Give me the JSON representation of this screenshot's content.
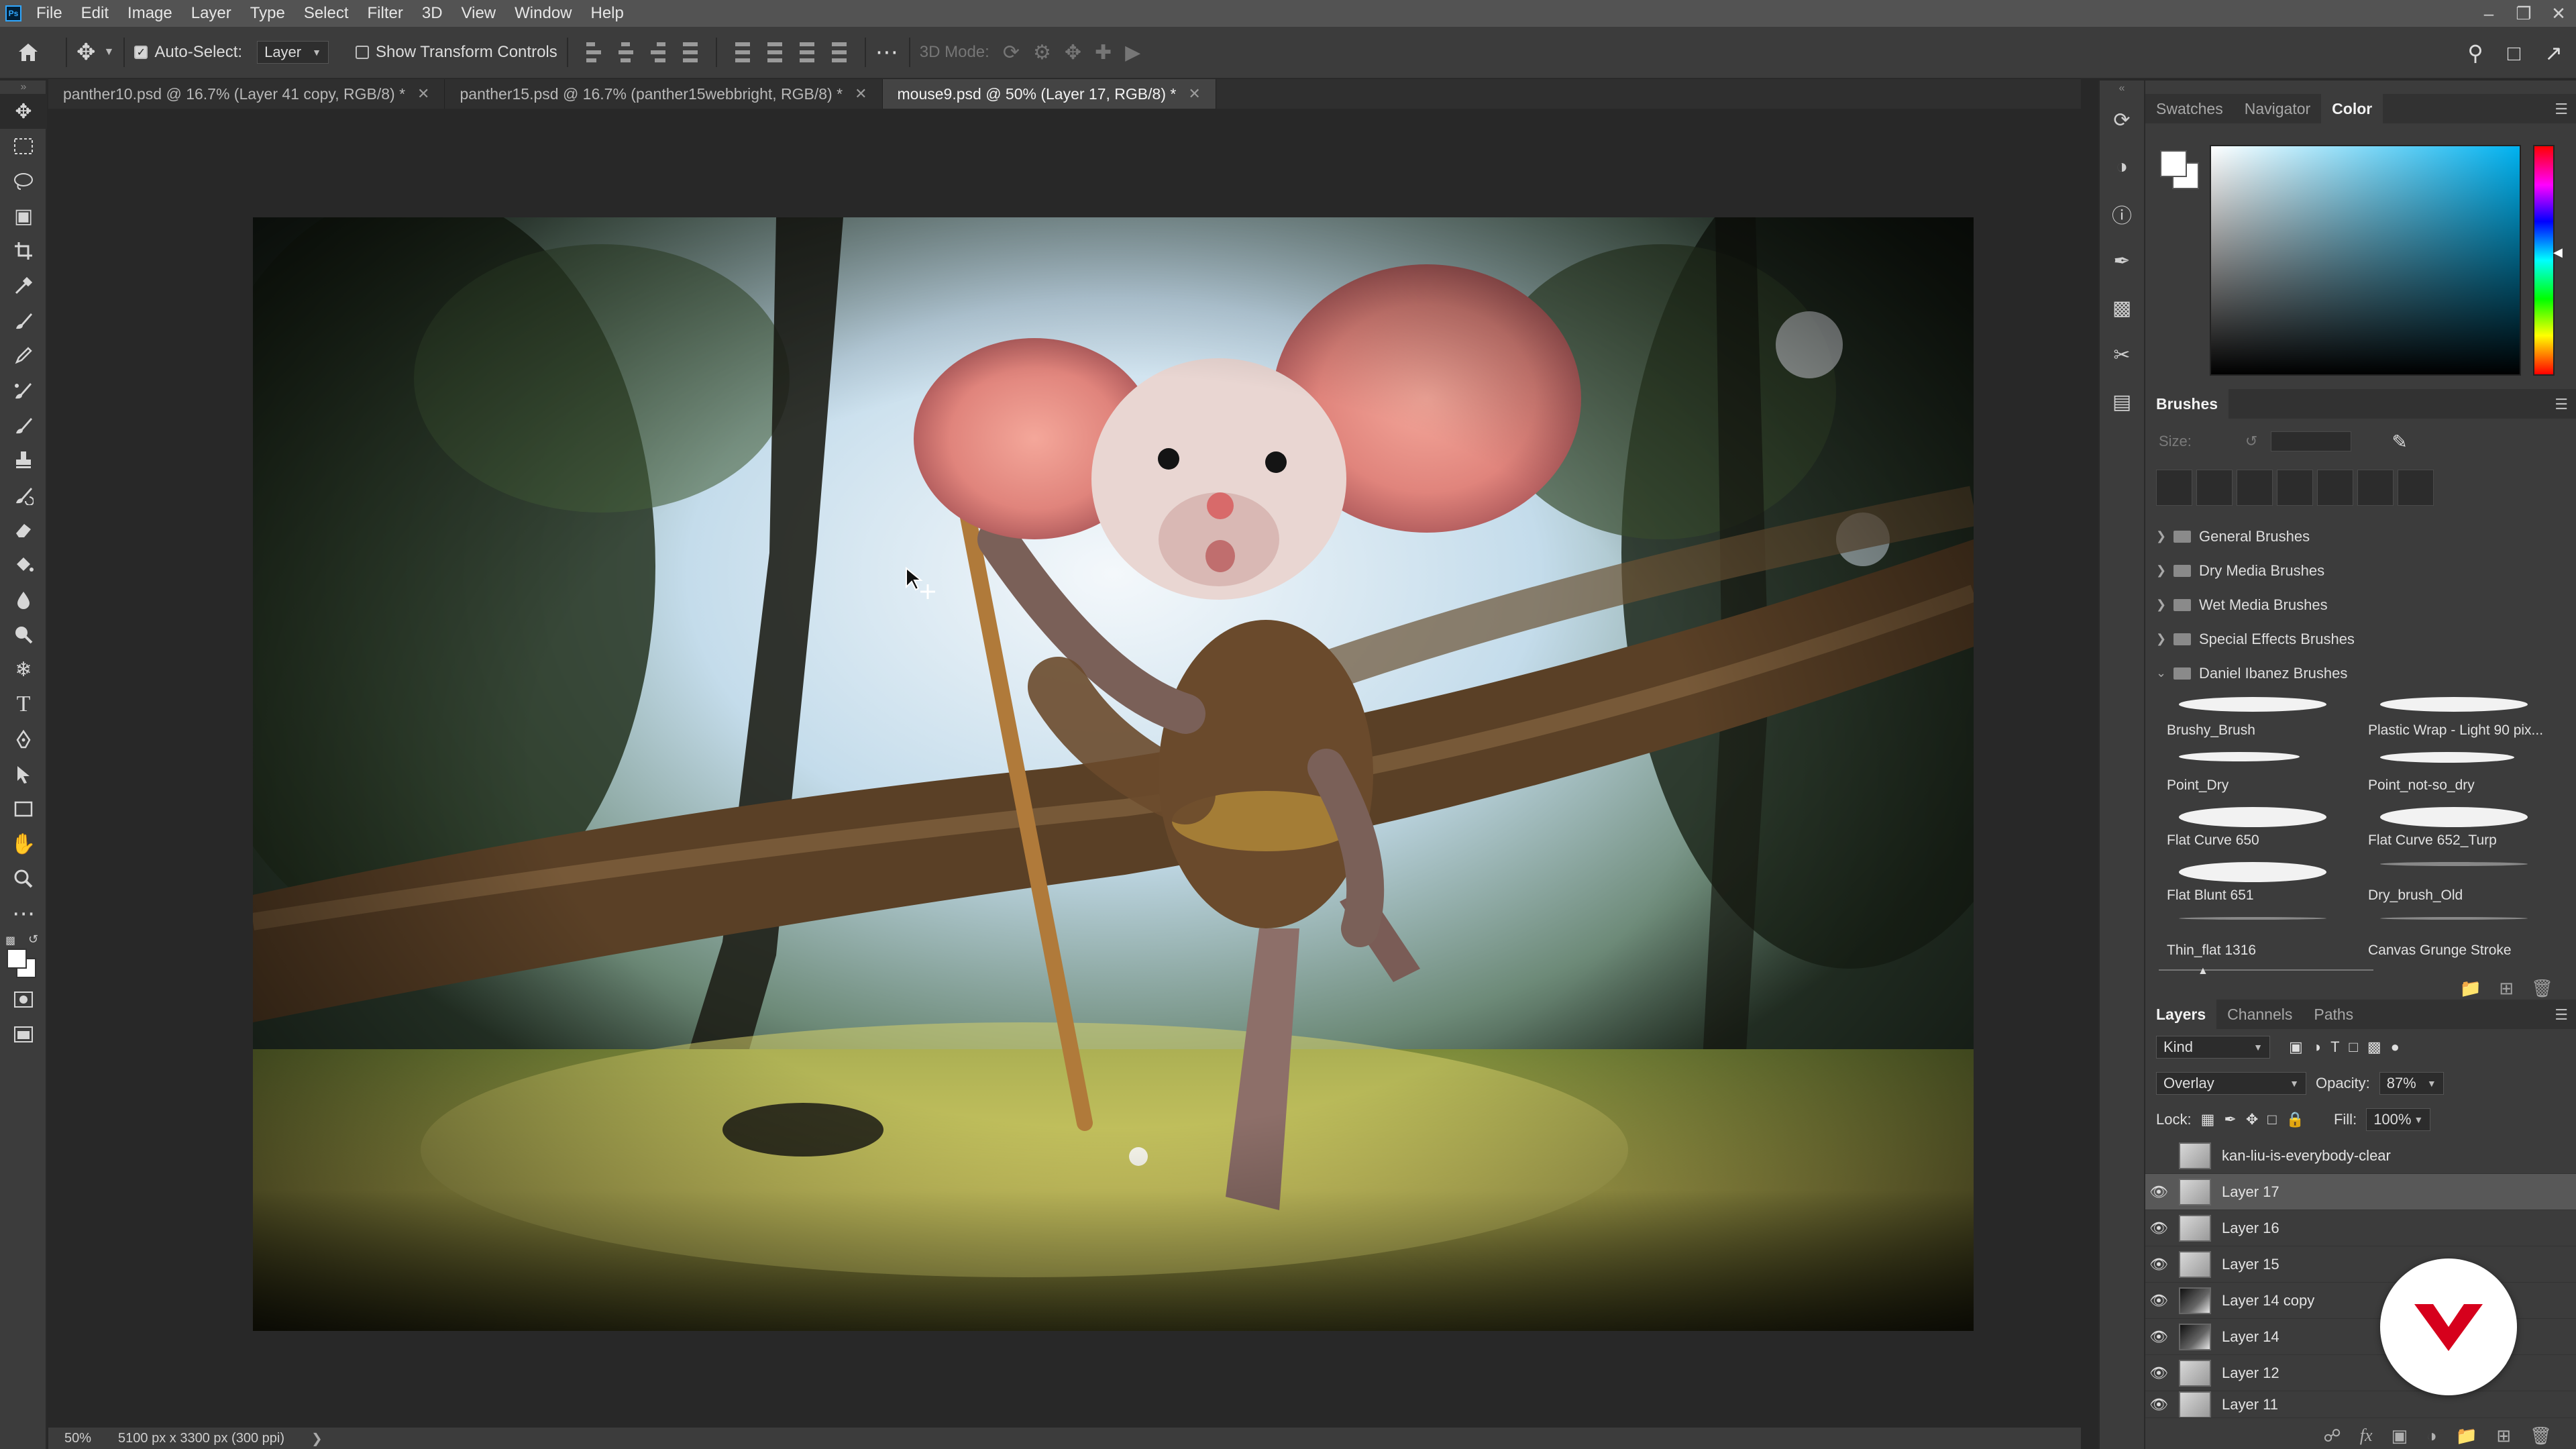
{
  "menubar": {
    "items": [
      "File",
      "Edit",
      "Image",
      "Layer",
      "Type",
      "Select",
      "Filter",
      "3D",
      "View",
      "Window",
      "Help"
    ]
  },
  "options": {
    "auto_select_label": "Auto-Select:",
    "auto_select_target": "Layer",
    "transform_label": "Show Transform Controls",
    "mode_3d_label": "3D Mode:"
  },
  "tabs": [
    {
      "label": "panther10.psd @ 16.7% (Layer 41 copy, RGB/8) *",
      "active": false
    },
    {
      "label": "panther15.psd @ 16.7% (panther15webbright, RGB/8) *",
      "active": false
    },
    {
      "label": "mouse9.psd @ 50% (Layer 17, RGB/8) *",
      "active": true
    }
  ],
  "status": {
    "zoom": "50%",
    "doc_size": "5100 px x 3300 px (300 ppi)"
  },
  "color_panel": {
    "tabs": [
      "Swatches",
      "Navigator",
      "Color"
    ],
    "active_tab": "Color",
    "hue_color": "#00b2f0"
  },
  "brushes": {
    "title": "Brushes",
    "size_label": "Size:",
    "folders": [
      {
        "name": "General Brushes",
        "open": false
      },
      {
        "name": "Dry Media Brushes",
        "open": false
      },
      {
        "name": "Wet Media Brushes",
        "open": false
      },
      {
        "name": "Special Effects Brushes",
        "open": false
      },
      {
        "name": "Daniel Ibanez Brushes",
        "open": true
      }
    ],
    "items": [
      "Brushy_Brush",
      "Plastic Wrap - Light 90 pix...",
      "Point_Dry",
      "Point_not-so_dry",
      "Flat Curve 650",
      "Flat Curve 652_Turp",
      "Flat Blunt 651",
      "Dry_brush_Old",
      "Thin_flat 1316",
      "Canvas Grunge Stroke"
    ]
  },
  "layers": {
    "tabs": [
      "Layers",
      "Channels",
      "Paths"
    ],
    "active_tab": "Layers",
    "filter_kind": "Kind",
    "blend_mode": "Overlay",
    "opacity_label": "Opacity:",
    "opacity_value": "87%",
    "lock_label": "Lock:",
    "fill_label": "Fill:",
    "fill_value": "100%",
    "rows": [
      {
        "name": "kan-liu-is-everybody-clear",
        "visible": false,
        "active": false
      },
      {
        "name": "Layer 17",
        "visible": true,
        "active": true
      },
      {
        "name": "Layer 16",
        "visible": true,
        "active": false
      },
      {
        "name": "Layer 15",
        "visible": true,
        "active": false
      },
      {
        "name": "Layer 14 copy",
        "visible": true,
        "active": false
      },
      {
        "name": "Layer 14",
        "visible": true,
        "active": false
      },
      {
        "name": "Layer 12",
        "visible": true,
        "active": false
      },
      {
        "name": "Layer 11",
        "visible": true,
        "active": false
      }
    ]
  },
  "colors": {
    "accent_red": "#d6001c",
    "ui_bg": "#3c3c3c",
    "canvas_bg": "#282828"
  }
}
